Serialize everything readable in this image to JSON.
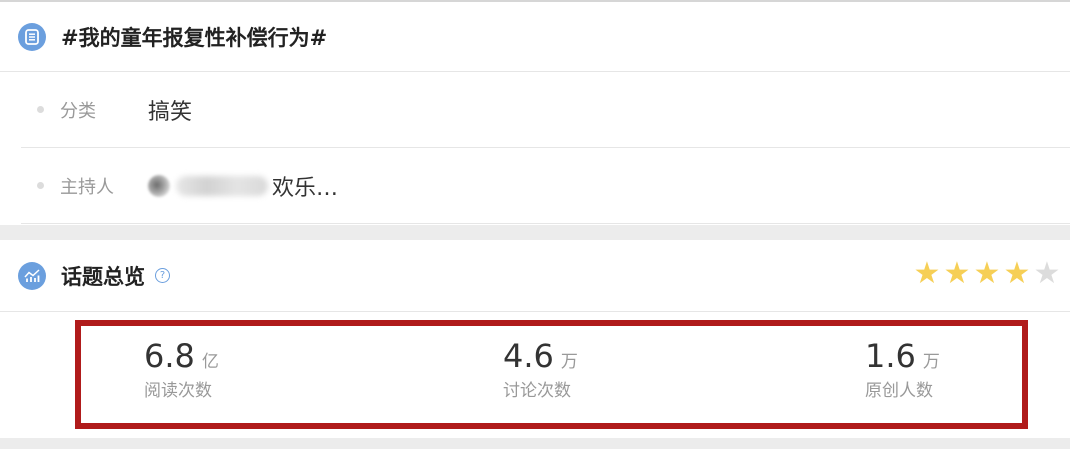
{
  "topic": {
    "title": "#我的童年报复性补偿行为#"
  },
  "info": {
    "category": {
      "label": "分类",
      "value": "搞笑"
    },
    "host": {
      "label": "主持人",
      "visible_text": "欢乐…"
    }
  },
  "overview": {
    "title": "话题总览",
    "help_glyph": "?",
    "rating": {
      "filled": 4,
      "total": 5
    },
    "stats": [
      {
        "value": "6.8",
        "unit": "亿",
        "label": "阅读次数"
      },
      {
        "value": "4.6",
        "unit": "万",
        "label": "讨论次数"
      },
      {
        "value": "1.6",
        "unit": "万",
        "label": "原创人数"
      }
    ]
  },
  "icons": {
    "topic": "list-icon",
    "overview": "chart-icon",
    "help": "question-icon",
    "star": "star-icon"
  },
  "colors": {
    "icon_blue": "#6b9fde",
    "star_filled": "#f6cf56",
    "star_empty": "#dcdcdc",
    "highlight_border": "#b01b1b"
  }
}
